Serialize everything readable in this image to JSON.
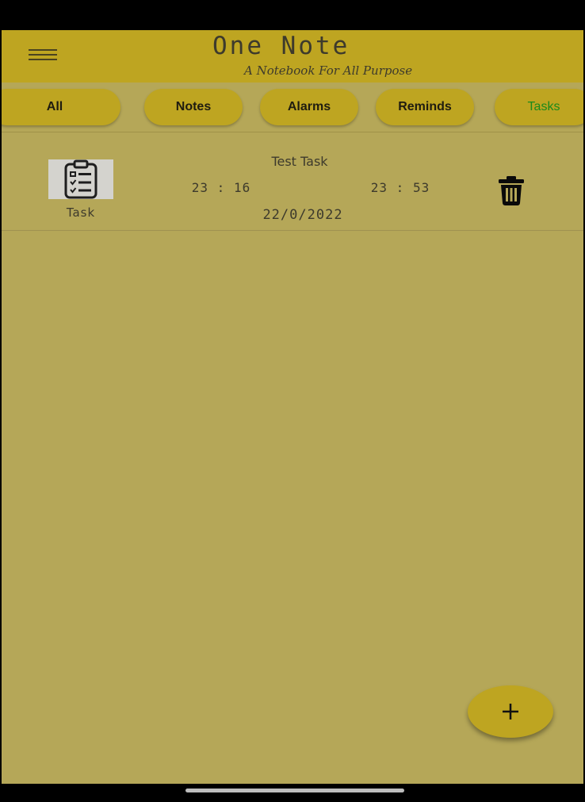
{
  "app": {
    "title": "One Note",
    "subtitle": "A Notebook For All Purpose"
  },
  "tabs": [
    {
      "label": "All",
      "active": false
    },
    {
      "label": "Notes",
      "active": false
    },
    {
      "label": "Alarms",
      "active": false
    },
    {
      "label": "Reminds",
      "active": false
    },
    {
      "label": "Tasks",
      "active": true
    }
  ],
  "tasks": [
    {
      "type": "Task",
      "icon": "clipboard-checklist-icon",
      "title": "Test Task",
      "start_time": "23 : 16",
      "end_time": "23 : 53",
      "date": "22/0/2022"
    }
  ],
  "fab": {
    "label": "+"
  },
  "colors": {
    "background": "#b5a758",
    "app_bar": "#bea521",
    "active_tab_text": "#1b8a1b",
    "text": "#3d3a2c"
  }
}
